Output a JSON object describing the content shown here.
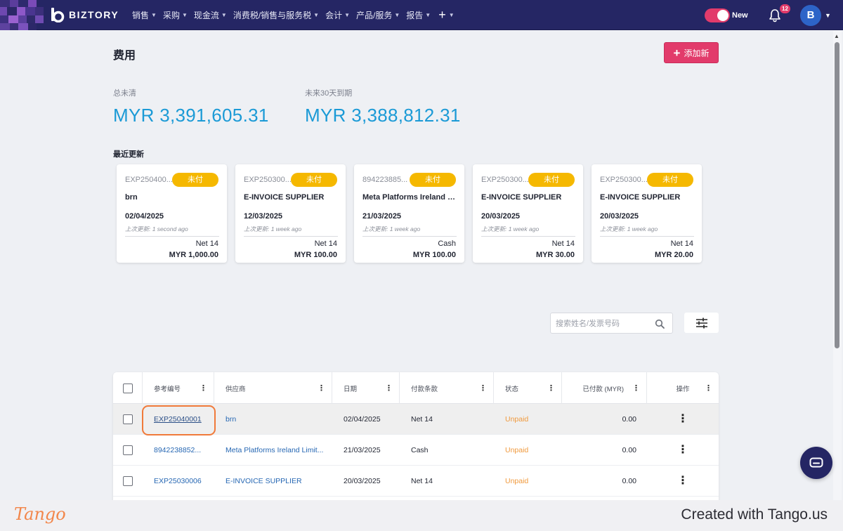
{
  "navbar": {
    "brand": "BIZTORY",
    "items": [
      {
        "label": "销售"
      },
      {
        "label": "采购"
      },
      {
        "label": "现金流"
      },
      {
        "label": "消费税/销售与服务税"
      },
      {
        "label": "会计"
      },
      {
        "label": "产品/服务"
      },
      {
        "label": "报告"
      }
    ],
    "plus_icon": "plus-icon",
    "toggle_label": "New",
    "notification_count": "12",
    "avatar_initial": "B",
    "colors": {
      "bar": "#252664",
      "accent": "#e23b6b"
    }
  },
  "page": {
    "title": "费用",
    "add_button_label": "添加新"
  },
  "summary": {
    "outstanding_label": "总未清",
    "outstanding_value": "MYR 3,391,605.31",
    "due30_label": "未来30天到期",
    "due30_value": "MYR 3,388,812.31"
  },
  "recent": {
    "title": "最近更新",
    "cards": [
      {
        "ref": "EXP250400...",
        "badge": "未付",
        "vendor": "brn",
        "date": "02/04/2025",
        "updated": "上次更新: 1 second ago",
        "term": "Net 14",
        "amount": "MYR 1,000.00"
      },
      {
        "ref": "EXP250300...",
        "badge": "未付",
        "vendor": "E-INVOICE SUPPLIER",
        "date": "12/03/2025",
        "updated": "上次更新: 1 week ago",
        "term": "Net 14",
        "amount": "MYR 100.00"
      },
      {
        "ref": "894223885...",
        "badge": "未付",
        "vendor": "Meta Platforms Ireland Li...",
        "date": "21/03/2025",
        "updated": "上次更新: 1 week ago",
        "term": "Cash",
        "amount": "MYR 100.00"
      },
      {
        "ref": "EXP250300...",
        "badge": "未付",
        "vendor": "E-INVOICE SUPPLIER",
        "date": "20/03/2025",
        "updated": "上次更新: 1 week ago",
        "term": "Net 14",
        "amount": "MYR 30.00"
      },
      {
        "ref": "EXP250300...",
        "badge": "未付",
        "vendor": "E-INVOICE SUPPLIER",
        "date": "20/03/2025",
        "updated": "上次更新: 1 week ago",
        "term": "Net 14",
        "amount": "MYR 20.00"
      }
    ],
    "badge_color": "#f5b800"
  },
  "search": {
    "placeholder": "搜索姓名/发票号码",
    "value": ""
  },
  "table": {
    "columns": [
      "参考编号",
      "供应商",
      "日期",
      "付款条款",
      "状态",
      "已付款 (MYR)",
      "操作"
    ],
    "rows": [
      {
        "ref": "EXP25040001",
        "vendor": "brn",
        "date": "02/04/2025",
        "term": "Net 14",
        "status": "Unpaid",
        "paid": "0.00"
      },
      {
        "ref": "8942238852...",
        "vendor": "Meta Platforms Ireland Limit...",
        "date": "21/03/2025",
        "term": "Cash",
        "status": "Unpaid",
        "paid": "0.00"
      },
      {
        "ref": "EXP25030006",
        "vendor": "E-INVOICE SUPPLIER",
        "date": "20/03/2025",
        "term": "Net 14",
        "status": "Unpaid",
        "paid": "0.00"
      }
    ]
  },
  "footer": {
    "tango_logo": "Tango",
    "created_with": "Created with Tango.us"
  }
}
